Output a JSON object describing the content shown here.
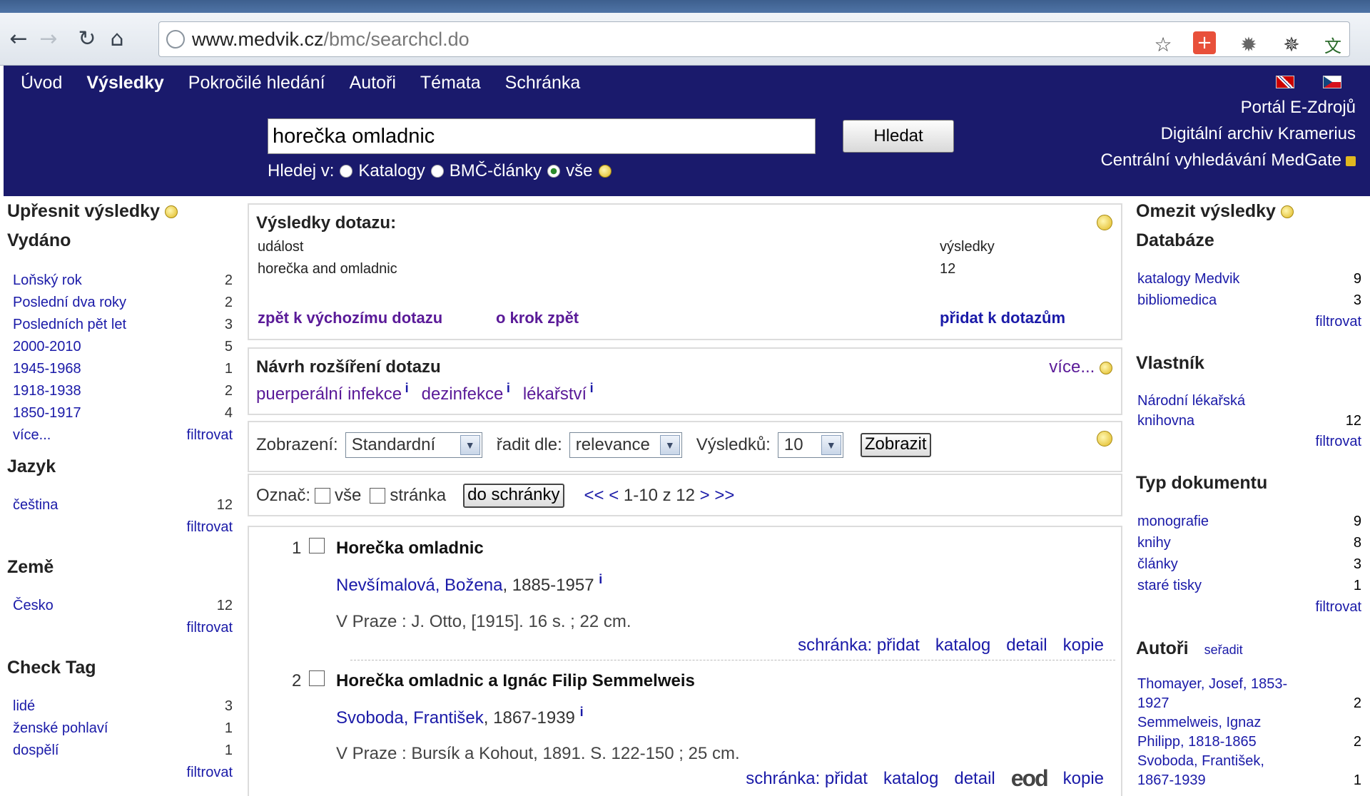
{
  "browser": {
    "url_host": "www.medvik.cz",
    "url_path": "/bmc/searchcl.do"
  },
  "nav": {
    "items": [
      "Úvod",
      "Výsledky",
      "Pokročilé hledání",
      "Autoři",
      "Témata",
      "Schránka"
    ],
    "active": "Výsledky"
  },
  "search": {
    "value": "horečka omladnic",
    "button": "Hledat",
    "scope_label": "Hledej v:",
    "scopes": [
      "Katalogy",
      "BMČ-články",
      "vše"
    ],
    "selected_scope": "vše"
  },
  "portals": [
    "Portál E-Zdrojů",
    "Digitální archiv Kramerius",
    "Centrální vyhledávání MedGate"
  ],
  "left": {
    "title": "Upřesnit výsledky",
    "filter_label": "filtrovat",
    "facets": [
      {
        "heading": "Vydáno",
        "items": [
          {
            "label": "Loňský rok",
            "count": "2"
          },
          {
            "label": "Poslední dva roky",
            "count": "2"
          },
          {
            "label": "Posledních pět let",
            "count": "3"
          },
          {
            "label": "2000-2010",
            "count": "5"
          },
          {
            "label": "1945-1968",
            "count": "1"
          },
          {
            "label": "1918-1938",
            "count": "2"
          },
          {
            "label": "1850-1917",
            "count": "4"
          }
        ],
        "more": "více..."
      },
      {
        "heading": "Jazyk",
        "items": [
          {
            "label": "čeština",
            "count": "12"
          }
        ]
      },
      {
        "heading": "Země",
        "items": [
          {
            "label": "Česko",
            "count": "12"
          }
        ]
      },
      {
        "heading": "Check Tag",
        "items": [
          {
            "label": "lidé",
            "count": "3"
          },
          {
            "label": "ženské pohlaví",
            "count": "1"
          },
          {
            "label": "dospělí",
            "count": "1"
          }
        ]
      }
    ]
  },
  "results_panel": {
    "title": "Výsledky dotazu:",
    "col_event": "událost",
    "col_results": "výsledky",
    "query": "horečka and omladnic",
    "count": "12",
    "back_initial": "zpět k výchozímu dotazu",
    "step_back": "o krok zpět",
    "add_query": "přidat k dotazům"
  },
  "suggest_panel": {
    "title": "Návrh rozšíření dotazu",
    "more": "více...",
    "terms": [
      "puerperální infekce",
      "dezinfekce",
      "lékařství"
    ],
    "info": "i"
  },
  "display_panel": {
    "display_label": "Zobrazení:",
    "display_value": "Standardní",
    "sort_label": "řadit dle:",
    "sort_value": "relevance",
    "results_label": "Výsledků:",
    "results_value": "10",
    "button": "Zobrazit"
  },
  "mark_panel": {
    "label": "Označ:",
    "all": "vše",
    "page": "stránka",
    "button": "do schránky",
    "pager_first": "<<",
    "pager_prev": "<",
    "pager_range": "1-10 z 12",
    "pager_next": ">",
    "pager_last": ">>"
  },
  "results": [
    {
      "num": "1",
      "title": "Horečka omladnic",
      "author": "Nevšímalová, Božena",
      "author_dates": ", 1885-1957",
      "pub": "V Praze : J. Otto, [1915]. 16 s. ; 22 cm.",
      "actions": [
        "schránka: přidat",
        "katalog",
        "detail",
        "kopie"
      ]
    },
    {
      "num": "2",
      "title": "Horečka omladnic a Ignác Filip Semmelweis",
      "author": "Svoboda, František",
      "author_dates": ", 1867-1939",
      "pub": "V Praze : Bursík a Kohout, 1891. S. 122-150 ; 25 cm.",
      "actions": [
        "schránka: přidat",
        "katalog",
        "detail",
        "kopie"
      ],
      "eod": "eod"
    }
  ],
  "right": {
    "title": "Omezit výsledky",
    "filter_label": "filtrovat",
    "databaze_heading": "Databáze",
    "databaze": [
      {
        "label": "katalogy Medvik",
        "count": "9"
      },
      {
        "label": "bibliomedica",
        "count": "3"
      }
    ],
    "vlastnik_heading": "Vlastník",
    "vlastnik_line1": "Národní lékařská",
    "vlastnik_line2": "knihovna",
    "vlastnik_count": "12",
    "typ_heading": "Typ dokumentu",
    "typ": [
      {
        "label": "monografie",
        "count": "9"
      },
      {
        "label": "knihy",
        "count": "8"
      },
      {
        "label": "články",
        "count": "3"
      },
      {
        "label": "staré tisky",
        "count": "1"
      }
    ],
    "autori_heading": "Autoři",
    "autori_sort": "seřadit",
    "autori": [
      {
        "line1": "Thomayer, Josef, 1853-",
        "line2": "1927",
        "count": "2"
      },
      {
        "line1": "Semmelweis, Ignaz",
        "line2": "Philipp, 1818-1865",
        "count": "2"
      },
      {
        "line1": "Svoboda, František,",
        "line2": "1867-1939",
        "count": "1"
      }
    ]
  }
}
